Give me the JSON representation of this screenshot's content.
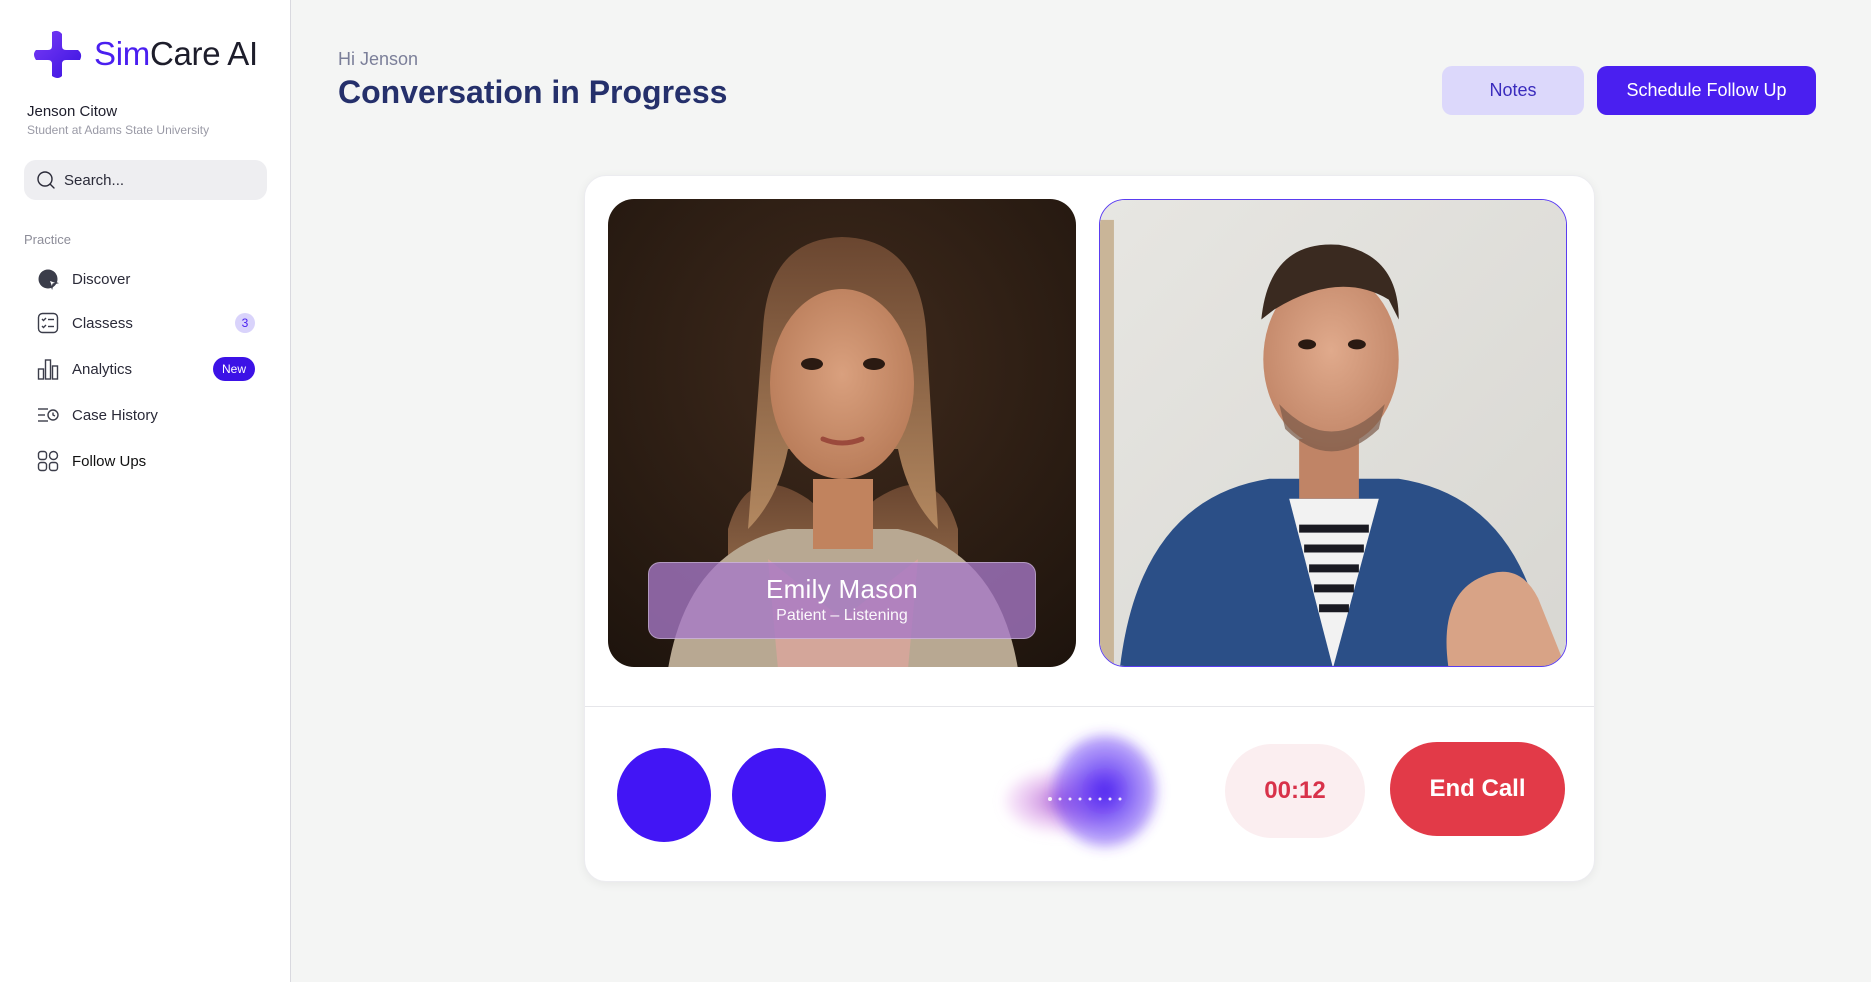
{
  "app": {
    "brand_part1": "Sim",
    "brand_part2": "Care AI",
    "accent_color": "#4a1ff0"
  },
  "user": {
    "name": "Jenson Citow",
    "subtitle": "Student at Adams State University"
  },
  "search": {
    "placeholder": "Search...",
    "icon": "search-icon"
  },
  "sidebar": {
    "section_label": "Practice",
    "items": [
      {
        "label": "Discover",
        "icon": "compass-icon"
      },
      {
        "label": "Classess",
        "icon": "checklist-icon",
        "badge": "3"
      },
      {
        "label": "Analytics",
        "icon": "bar-chart-icon",
        "badge": "New"
      },
      {
        "label": "Case History",
        "icon": "history-list-icon"
      },
      {
        "label": "Follow Ups",
        "icon": "grid-icon"
      }
    ]
  },
  "header": {
    "greeting": "Hi Jenson",
    "title": "Conversation in Progress",
    "notes_label": "Notes",
    "schedule_label": "Schedule Follow Up"
  },
  "call": {
    "patient_name": "Emily Mason",
    "patient_status": "Patient – Listening",
    "timer": "00:12",
    "end_call_label": "End Call",
    "end_call_color": "#e23a48"
  }
}
